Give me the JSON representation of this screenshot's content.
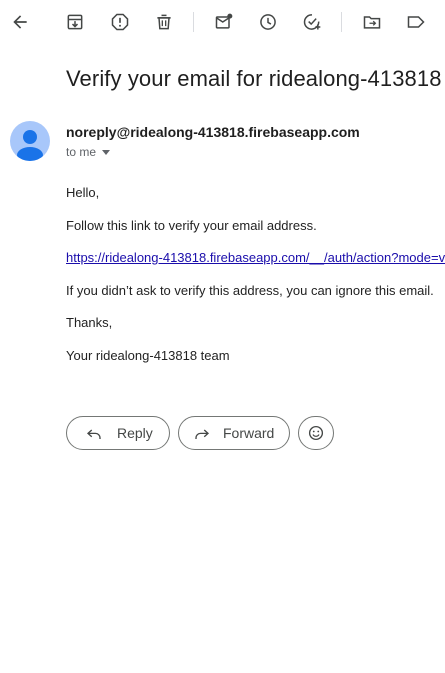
{
  "toolbar": {
    "icons": [
      "back-arrow-icon",
      "archive-icon",
      "report-spam-icon",
      "delete-icon",
      "mark-unread-icon",
      "snooze-icon",
      "add-to-tasks-icon",
      "move-to-icon",
      "label-icon"
    ]
  },
  "email": {
    "subject": "Verify your email for ridealong-413818",
    "sender": "noreply@ridealong-413818.firebaseapp.com",
    "recipient_label": "to me",
    "greeting": "Hello,",
    "line1": "Follow this link to verify your email address.",
    "link": "https://ridealong-413818.firebaseapp.com/__/auth/action?mode=v",
    "line2": "If you didn’t ask to verify this address, you can ignore this email.",
    "thanks": "Thanks,",
    "signature": "Your ridealong-413818 team"
  },
  "actions": {
    "reply_label": "Reply",
    "forward_label": "Forward"
  },
  "colors": {
    "avatar_bg": "#a8c7fa",
    "avatar_fg": "#1a73e8",
    "link": "#1a0dab",
    "icon": "#444746"
  }
}
